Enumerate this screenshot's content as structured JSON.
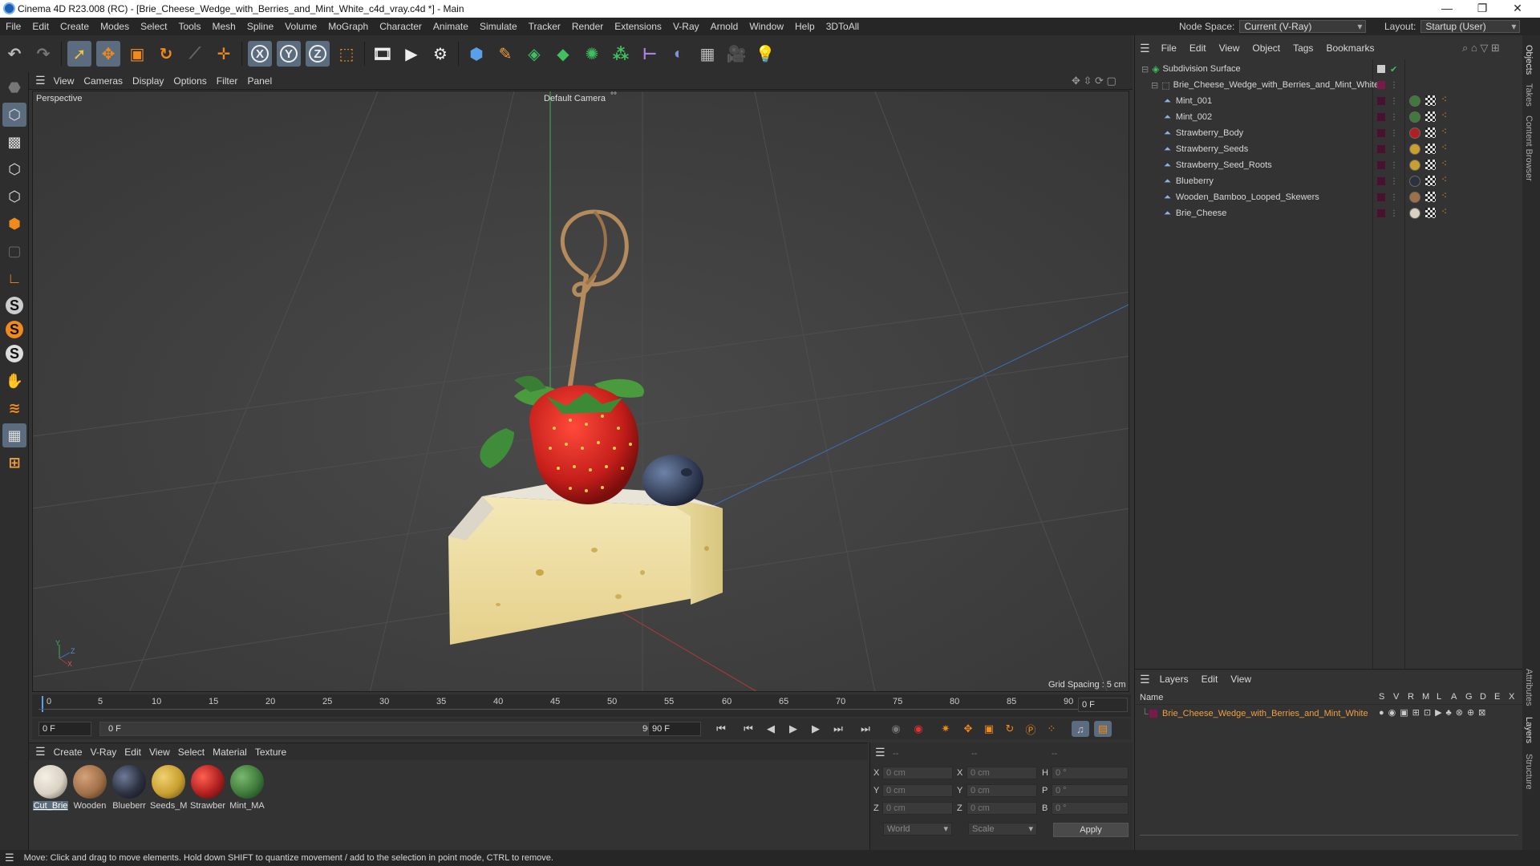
{
  "window": {
    "title": "Cinema 4D R23.008 (RC) - [Brie_Cheese_Wedge_with_Berries_and_Mint_White_c4d_vray.c4d *] - Main",
    "minimize": "—",
    "maximize": "❐",
    "close": "✕"
  },
  "menubar": {
    "items": [
      "File",
      "Edit",
      "Create",
      "Modes",
      "Select",
      "Tools",
      "Mesh",
      "Spline",
      "Volume",
      "MoGraph",
      "Character",
      "Animate",
      "Simulate",
      "Tracker",
      "Render",
      "Extensions",
      "V-Ray",
      "Arnold",
      "Window",
      "Help",
      "3DToAll"
    ],
    "node_space_label": "Node Space:",
    "node_space_value": "Current (V-Ray)",
    "layout_label": "Layout:",
    "layout_value": "Startup (User)"
  },
  "toolbar": {
    "icons": [
      "undo-icon",
      "redo-icon",
      "live-select-icon",
      "move-icon",
      "scale-icon",
      "rotate-icon",
      "recent-tools-icon",
      "add-icon",
      "x-axis-icon",
      "y-axis-icon",
      "z-axis-icon",
      "coordinate-system-icon",
      "render-view-icon",
      "render-picture-viewer-icon",
      "render-settings-icon",
      "cube-icon",
      "pen-icon",
      "subdivision-icon",
      "extrude-icon",
      "cloner-icon",
      "mograph-icon",
      "spline-icon",
      "deformer-icon",
      "floor-icon",
      "camera-icon",
      "light-icon"
    ],
    "axis_labels": [
      "X",
      "Y",
      "Z"
    ]
  },
  "left_toolbar": {
    "snap_labels": [
      "S",
      "S",
      "S"
    ]
  },
  "viewport": {
    "menu": [
      "View",
      "Cameras",
      "Display",
      "Options",
      "Filter",
      "Panel"
    ],
    "view_name": "Perspective",
    "camera_name": "Default Camera",
    "camera_suffix": "°°",
    "grid_spacing": "Grid Spacing : 5 cm",
    "axis_x": "X",
    "axis_y": "Y",
    "axis_z": "Z"
  },
  "timeline": {
    "ticks": [
      "0",
      "5",
      "10",
      "15",
      "20",
      "25",
      "30",
      "35",
      "40",
      "45",
      "50",
      "55",
      "60",
      "65",
      "70",
      "75",
      "80",
      "85",
      "90"
    ],
    "current_frame": "0 F",
    "start_frame": "0 F",
    "range_start": "0 F",
    "range_end": "90 F",
    "end_frame": "90 F"
  },
  "materials": {
    "menu": [
      "Create",
      "V-Ray",
      "Edit",
      "View",
      "Select",
      "Material",
      "Texture"
    ],
    "items": [
      {
        "name": "Cut_Brie",
        "color": "#d9d2c2"
      },
      {
        "name": "Wooden",
        "color": "#a07048"
      },
      {
        "name": "Blueberr",
        "color": "#2c3140"
      },
      {
        "name": "Seeds_M",
        "color": "#c9a030"
      },
      {
        "name": "Strawber",
        "color": "#b02020"
      },
      {
        "name": "Mint_MA",
        "color": "#3f7a3a"
      }
    ]
  },
  "coordinates": {
    "headers": [
      "--",
      "--",
      "--"
    ],
    "rows": [
      {
        "l1": "X",
        "v1": "0 cm",
        "l2": "X",
        "v2": "0 cm",
        "l3": "H",
        "v3": "0 °"
      },
      {
        "l1": "Y",
        "v1": "0 cm",
        "l2": "Y",
        "v2": "0 cm",
        "l3": "P",
        "v3": "0 °"
      },
      {
        "l1": "Z",
        "v1": "0 cm",
        "l2": "Z",
        "v2": "0 cm",
        "l3": "B",
        "v3": "0 °"
      }
    ],
    "mode": "World",
    "transform": "Scale",
    "apply": "Apply"
  },
  "objects": {
    "menu": [
      "File",
      "Edit",
      "View",
      "Object",
      "Tags",
      "Bookmarks"
    ],
    "root": "Subdivision Surface",
    "group": "Brie_Cheese_Wedge_with_Berries_and_Mint_White",
    "children": [
      {
        "name": "Mint_001",
        "mat": "#3f7a3a"
      },
      {
        "name": "Mint_002",
        "mat": "#3f7a3a"
      },
      {
        "name": "Strawberry_Body",
        "mat": "#b02020"
      },
      {
        "name": "Strawberry_Seeds",
        "mat": "#c9a030"
      },
      {
        "name": "Strawberry_Seed_Roots",
        "mat": "#c9a030"
      },
      {
        "name": "Blueberry",
        "mat": "#2c3140"
      },
      {
        "name": "Wooden_Bamboo_Looped_Skewers",
        "mat": "#a07048"
      },
      {
        "name": "Brie_Cheese",
        "mat": "#d9d2c2"
      }
    ]
  },
  "layers": {
    "menu": [
      "Layers",
      "Edit",
      "View"
    ],
    "name_header": "Name",
    "columns": [
      "S",
      "V",
      "R",
      "M",
      "L",
      "A",
      "G",
      "D",
      "E",
      "X"
    ],
    "layer_name": "Brie_Cheese_Wedge_with_Berries_and_Mint_White",
    "layer_color": "#7a1a4a"
  },
  "right_tabs": [
    "Objects",
    "Takes",
    "Content Browser",
    "Attributes",
    "Layers",
    "Structure"
  ],
  "status": "Move: Click and drag to move elements. Hold down SHIFT to quantize movement / add to the selection in point mode, CTRL to remove.",
  "colors": {
    "accent_orange": "#f08a1c",
    "selected_blue": "#5a6c7d",
    "layer_text": "#f0a040"
  }
}
